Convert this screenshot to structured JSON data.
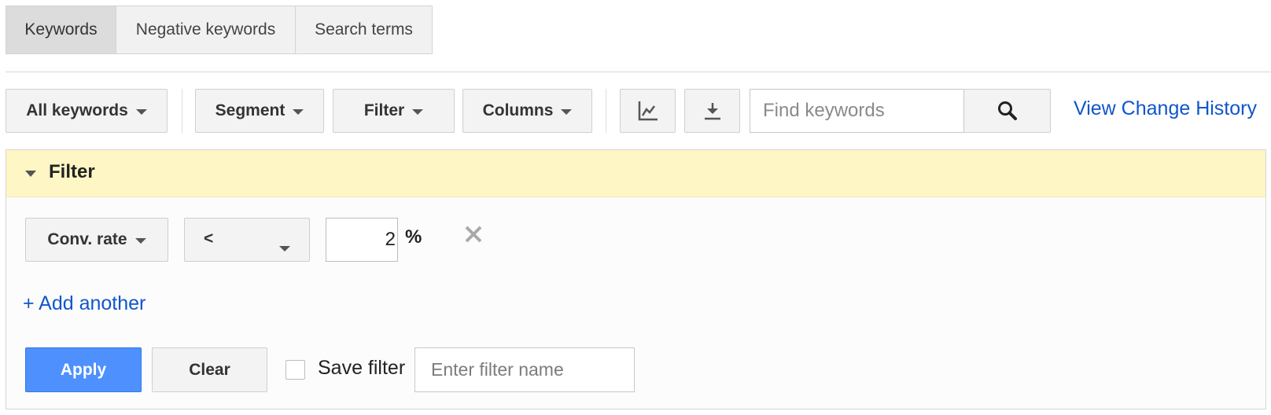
{
  "tabs": [
    {
      "label": "Keywords",
      "selected": true
    },
    {
      "label": "Negative keywords",
      "selected": false
    },
    {
      "label": "Search terms",
      "selected": false
    }
  ],
  "toolbar": {
    "all_keywords_label": "All keywords",
    "segment_label": "Segment",
    "filter_label": "Filter",
    "columns_label": "Columns",
    "search": {
      "placeholder": "Find keywords",
      "value": ""
    },
    "view_change_history_label": "View Change History"
  },
  "filter_panel": {
    "title": "Filter",
    "condition": {
      "field_label": "Conv. rate",
      "operator_label": "<",
      "value": "2",
      "unit": "%"
    },
    "add_another_label": "+ Add another",
    "apply_label": "Apply",
    "clear_label": "Clear",
    "save_filter_label": "Save filter",
    "save_filter_checked": false,
    "filter_name": {
      "placeholder": "Enter filter name",
      "value": ""
    }
  },
  "colors": {
    "accent_blue": "#4d90fe",
    "link_blue": "#1155cc",
    "filter_header_bg": "#fff6c5"
  }
}
